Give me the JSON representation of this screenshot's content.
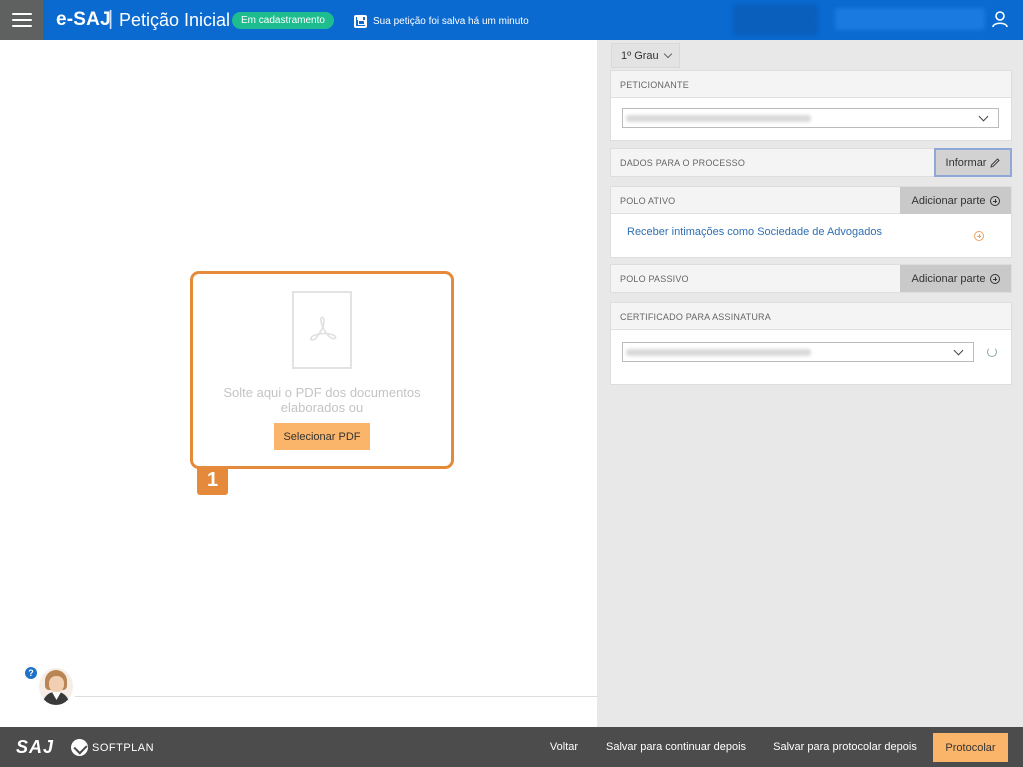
{
  "header": {
    "brand": "e-SAJ",
    "separator": "|",
    "title": "Petição Inicial",
    "status_badge": "Em cadastramento",
    "save_status": "Sua petição foi salva há um minuto",
    "colors": {
      "bar": "#0a6ad0",
      "badge": "#1ebd8f",
      "menu": "#5f6060"
    }
  },
  "dropzone": {
    "text": "Solte aqui o PDF dos documentos elaborados ou",
    "button": "Selecionar PDF",
    "step_number": "1"
  },
  "right_panel": {
    "grau": "1º Grau",
    "peticionante": {
      "label": "PETICIONANTE"
    },
    "dados": {
      "label": "DADOS PARA O PROCESSO",
      "button": "Informar"
    },
    "polo_ativo": {
      "label": "POLO ATIVO",
      "button": "Adicionar parte",
      "link": "Receber intimações como Sociedade de Advogados"
    },
    "polo_passivo": {
      "label": "POLO PASSIVO",
      "button": "Adicionar parte"
    },
    "certificado": {
      "label": "CERTIFICADO PARA ASSINATURA"
    }
  },
  "help": {
    "icon_text": "?"
  },
  "footer": {
    "logo": "SAJ",
    "company": "SOFTPLAN",
    "back": "Voltar",
    "save_continue": "Salvar para continuar depois",
    "save_protocol": "Salvar para protocolar depois",
    "protocol": "Protocolar",
    "accent": "#fbb56a"
  }
}
